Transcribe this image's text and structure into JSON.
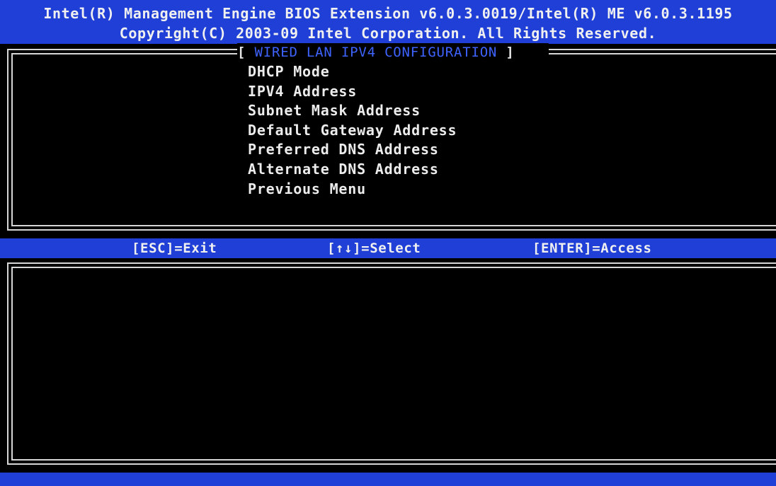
{
  "header": {
    "line1": "Intel(R) Management Engine BIOS Extension v6.0.3.0019/Intel(R) ME v6.0.3.1195",
    "line2": "Copyright(C) 2003-09 Intel Corporation.  All Rights Reserved."
  },
  "section": {
    "bracket_open": "[ ",
    "title": "WIRED LAN IPV4 CONFIGURATION",
    "bracket_close": " ]"
  },
  "menu": {
    "items": [
      {
        "label": "DHCP Mode",
        "selected": true
      },
      {
        "label": "IPV4 Address",
        "selected": false
      },
      {
        "label": "Subnet Mask Address",
        "selected": false
      },
      {
        "label": "Default Gateway Address",
        "selected": false
      },
      {
        "label": "Preferred DNS Address",
        "selected": false
      },
      {
        "label": "Alternate DNS Address",
        "selected": false
      },
      {
        "label": "Previous Menu",
        "selected": false
      }
    ]
  },
  "keys": {
    "exit": "[ESC]=Exit",
    "select": "[↑↓]=Select",
    "access": "[ENTER]=Access"
  },
  "colors": {
    "bar_blue": "#1f3fd6",
    "title_blue": "#3e63ff",
    "highlight": "#dedede"
  }
}
